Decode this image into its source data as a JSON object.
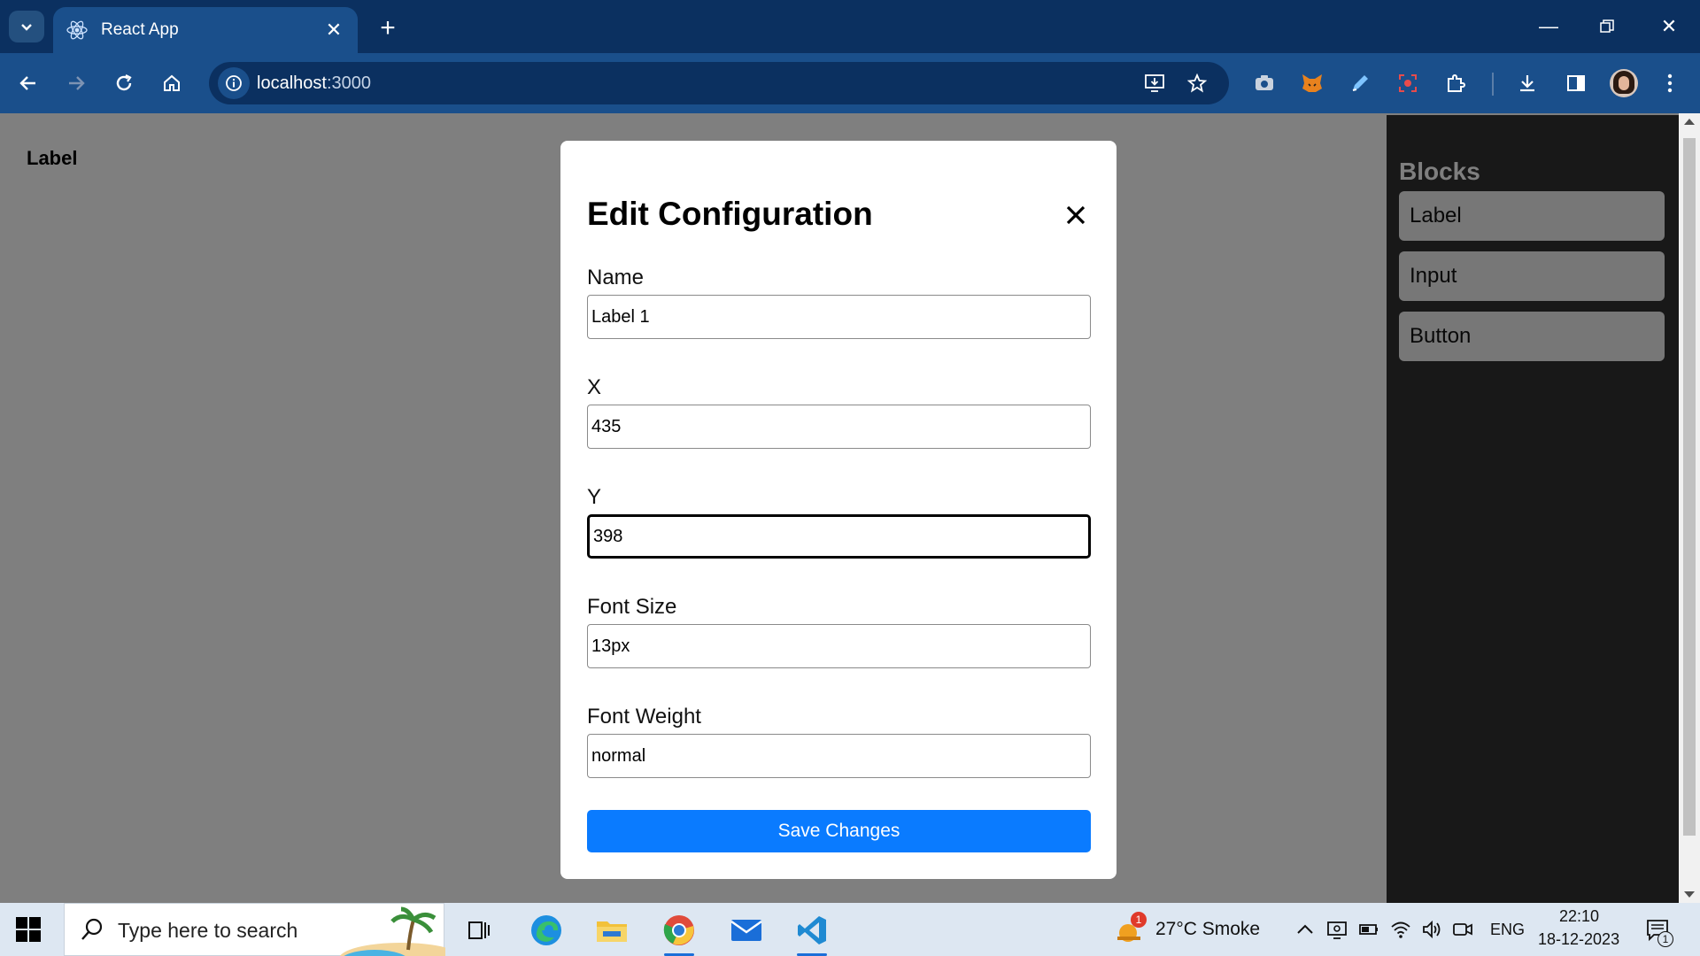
{
  "browser": {
    "tab_title": "React App",
    "url_host": "localhost",
    "url_port": ":3000"
  },
  "page": {
    "canvas_label": "Label"
  },
  "sidebar": {
    "title": "Blocks",
    "blocks": [
      "Label",
      "Input",
      "Button"
    ]
  },
  "modal": {
    "title": "Edit Configuration",
    "fields": {
      "name": {
        "label": "Name",
        "value": "Label 1"
      },
      "x": {
        "label": "X",
        "value": "435"
      },
      "y": {
        "label": "Y",
        "value": "398"
      },
      "font_size": {
        "label": "Font Size",
        "value": "13px"
      },
      "font_weight": {
        "label": "Font Weight",
        "value": "normal"
      }
    },
    "save_label": "Save Changes"
  },
  "taskbar": {
    "search_placeholder": "Type here to search",
    "weather": "27°C  Smoke",
    "weather_badge": "1",
    "language": "ENG",
    "time": "22:10",
    "date": "18-12-2023",
    "notification_count": "1"
  },
  "colors": {
    "browser_dark": "#0b3060",
    "browser_toolbar": "#1a4f8b",
    "sidebar": "#303030",
    "primary_button": "#0a7bff"
  }
}
